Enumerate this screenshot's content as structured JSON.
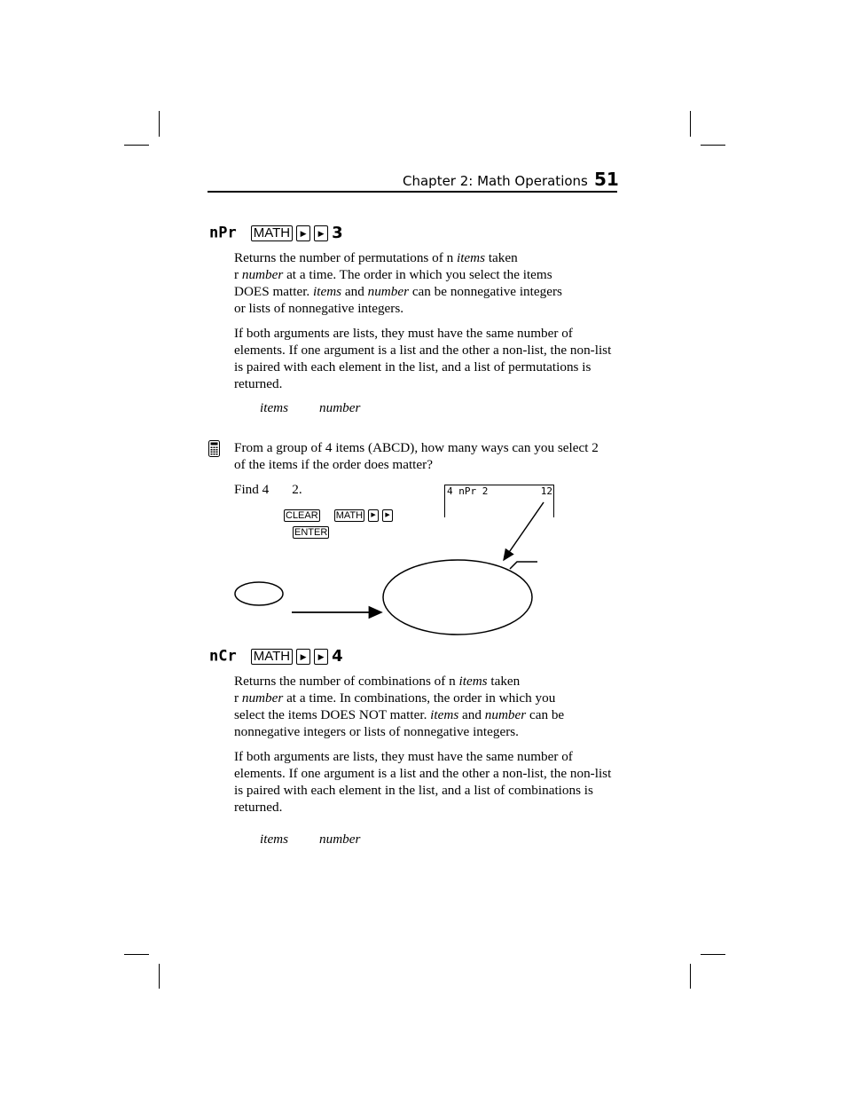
{
  "header": {
    "chapter": "Chapter 2: Math Operations",
    "page_number": "51"
  },
  "npr": {
    "title": "nPr",
    "keys": [
      "MATH",
      "▶",
      "▶"
    ],
    "key_number": "3",
    "para1": {
      "parts": [
        "Returns the number of permutations of n ",
        "items",
        " taken",
        "r ",
        "number",
        " at a time. The order in which you select the items",
        "DOES matter. ",
        "items",
        " and ",
        "number",
        " can be nonnegative integers",
        "or lists of nonnegative integers."
      ]
    },
    "para2": "If both arguments are lists, they must have the same number of elements. If one argument is a list and the other a non-list, the non-list is paired with each element in the list, and a list of permutations is returned.",
    "syntax_items": "items",
    "syntax_number": "number"
  },
  "example": {
    "icon": "calculator-icon",
    "question": "From a group of 4 items (ABCD), how many ways can you select 2 of the items if the order does matter?",
    "find_prefix": "Find 4",
    "find_suffix": "2.",
    "keys_line1": [
      "CLEAR",
      "MATH",
      "▶",
      "▶"
    ],
    "keys_line2": [
      "ENTER"
    ],
    "screen": {
      "expression": "4 nPr 2",
      "result": "12"
    }
  },
  "ncr": {
    "title": "nCr",
    "keys": [
      "MATH",
      "▶",
      "▶"
    ],
    "key_number": "4",
    "para1": {
      "parts": [
        "Returns the number of combinations of n ",
        "items",
        " taken",
        "r ",
        "number",
        " at a time. In combinations, the order in which you",
        "select the items DOES NOT matter. ",
        "items",
        " and ",
        "number",
        " can be",
        "nonnegative integers or lists of nonnegative integers."
      ]
    },
    "para2": "If both arguments are lists, they must have the same number of elements. If one argument is a list and the other a non-list, the non-list is paired with each element in the list, and a list of combinations is returned.",
    "syntax_items": "items",
    "syntax_number": "number"
  }
}
